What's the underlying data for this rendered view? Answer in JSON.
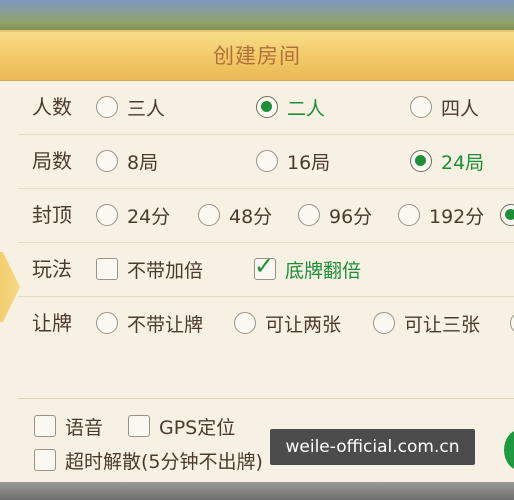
{
  "dialog": {
    "title": "创建房间"
  },
  "rows": {
    "players": {
      "label": "人数",
      "options": [
        {
          "label": "三人",
          "selected": false
        },
        {
          "label": "二人",
          "selected": true
        },
        {
          "label": "四人",
          "selected": false
        }
      ]
    },
    "rounds": {
      "label": "局数",
      "options": [
        {
          "label": "8局",
          "selected": false
        },
        {
          "label": "16局",
          "selected": false
        },
        {
          "label": "24局",
          "selected": true
        }
      ]
    },
    "cap": {
      "label": "封顶",
      "options": [
        {
          "label": "24分",
          "selected": false
        },
        {
          "label": "48分",
          "selected": false
        },
        {
          "label": "96分",
          "selected": false
        },
        {
          "label": "192分",
          "selected": false
        }
      ]
    },
    "play": {
      "label": "玩法",
      "options": [
        {
          "label": "不带加倍",
          "checked": false
        },
        {
          "label": "底牌翻倍",
          "checked": true
        }
      ]
    },
    "concede": {
      "label": "让牌",
      "options": [
        {
          "label": "不带让牌",
          "selected": false
        },
        {
          "label": "可让两张",
          "selected": false
        },
        {
          "label": "可让三张",
          "selected": false
        }
      ]
    }
  },
  "bottom": {
    "voice": {
      "label": "语音",
      "checked": false
    },
    "gps": {
      "label": "GPS定位",
      "checked": false
    },
    "timeout": {
      "label": "超时解散(5分钟不出牌)",
      "checked": false
    }
  },
  "watermark": "weile-official.com.cn",
  "colors": {
    "accent_green": "#1c8f38",
    "title_bar": "#f2c866",
    "title_text": "#b0713a",
    "panel_bg": "#f6f1e3"
  }
}
